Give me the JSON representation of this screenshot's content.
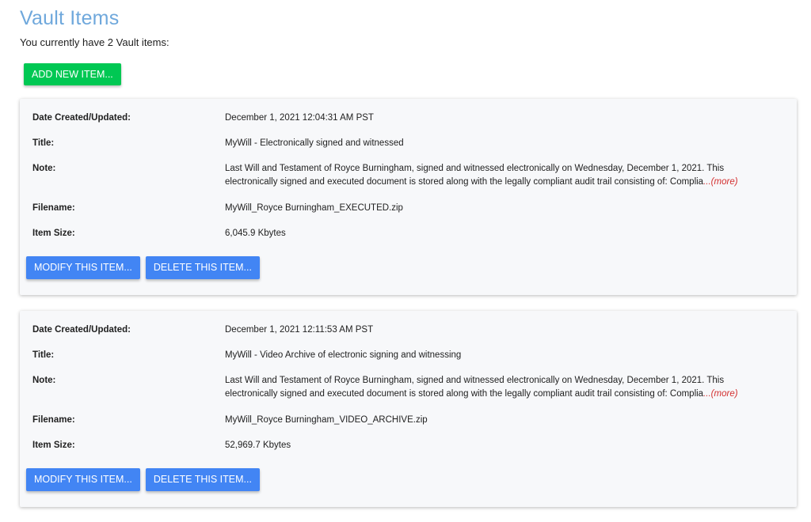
{
  "header": {
    "title": "Vault Items",
    "subtitle": "You currently have 2 Vault items:",
    "add_button": "ADD NEW ITEM..."
  },
  "labels": {
    "date": "Date Created/Updated:",
    "title": "Title:",
    "note": "Note:",
    "filename": "Filename:",
    "size": "Item Size:"
  },
  "items": [
    {
      "date": "December 1, 2021  12:04:31 AM PST",
      "title": "MyWill - Electronically signed and witnessed",
      "note": "Last Will and Testament of Royce Burningham, signed and witnessed electronically on Wednesday, December 1, 2021. This electronically signed and executed document is stored along with the legally compliant audit trail consisting of: Complia",
      "more": "...(more)",
      "filename": "MyWill_Royce Burningham_EXECUTED.zip",
      "size": "6,045.9 Kbytes",
      "modify_label": "MODIFY THIS ITEM...",
      "delete_label": "DELETE THIS ITEM..."
    },
    {
      "date": "December 1, 2021  12:11:53 AM PST",
      "title": "MyWill - Video Archive of electronic signing and witnessing",
      "note": "Last Will and Testament of Royce Burningham, signed and witnessed electronically on Wednesday, December 1, 2021. This electronically signed and executed document is stored along with the legally compliant audit trail consisting of: Complia",
      "more": "...(more)",
      "filename": "MyWill_Royce Burningham_VIDEO_ARCHIVE.zip",
      "size": "52,969.7 Kbytes",
      "modify_label": "MODIFY THIS ITEM...",
      "delete_label": "DELETE THIS ITEM..."
    }
  ],
  "colors": {
    "title": "#6fa8dc",
    "add_button": "#00c853",
    "action_button": "#4285f4",
    "more_link": "#d32f2f",
    "card_background": "#f7f8fa"
  }
}
